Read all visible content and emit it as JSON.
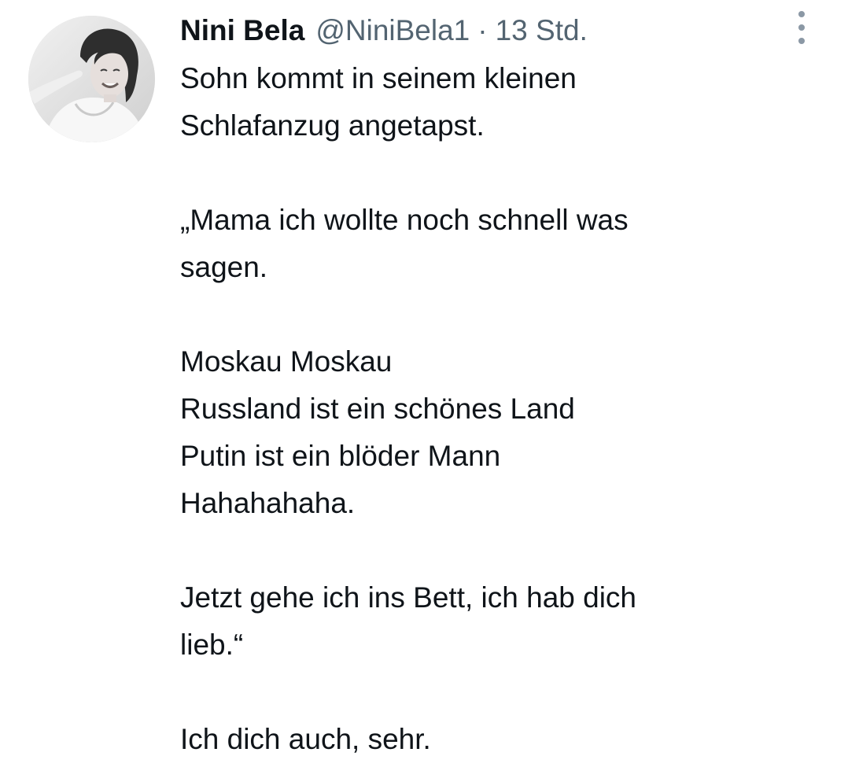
{
  "author": {
    "display_name": "Nini Bela",
    "handle": "@NiniBela1",
    "separator": "·",
    "timestamp": "13 Std.",
    "avatar": "profile-photo-woman-black-and-white"
  },
  "more_menu": {
    "icon": "more-options-vertical-dots-icon"
  },
  "tweet": {
    "lines": [
      "Sohn kommt in seinem kleinen",
      "Schlafanzug angetapst.",
      "",
      "„Mama ich wollte noch schnell was",
      "sagen.",
      "",
      "Moskau Moskau",
      "Russland ist ein schönes Land",
      "Putin ist ein blöder Mann",
      "Hahahahaha.",
      "",
      "Jetzt gehe ich ins Bett, ich hab dich",
      "lieb.“",
      "",
      "Ich dich auch, sehr."
    ]
  },
  "colors": {
    "text_primary": "#0f1419",
    "text_secondary": "#536471",
    "icon_gray": "#8b98a5",
    "background": "#ffffff"
  }
}
